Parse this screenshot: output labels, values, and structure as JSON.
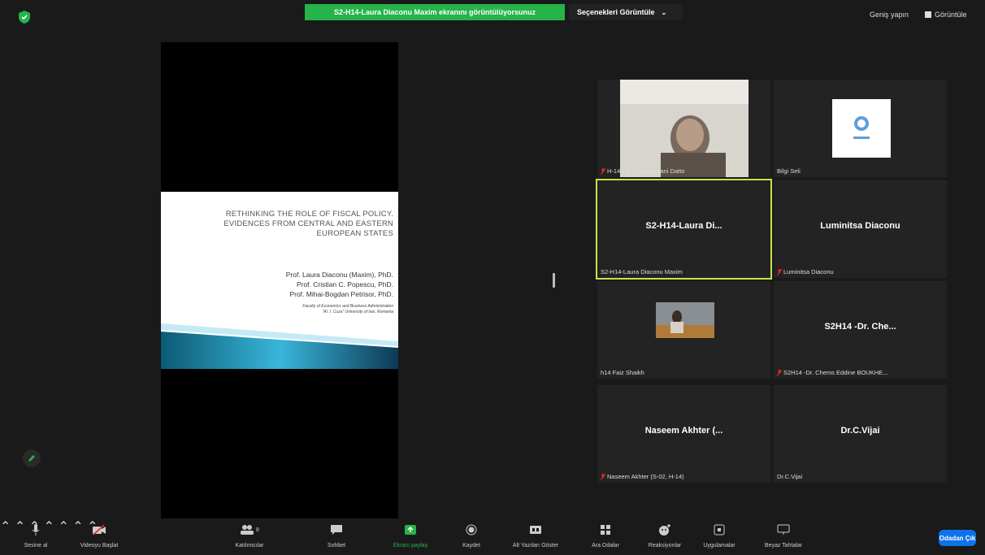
{
  "top": {
    "share_banner": "S2-H14-Laura Diaconu Maxim ekranını görüntülüyorsunuz",
    "view_options": "Seçenekleri Görüntüle",
    "exit_fullscreen": "Geniş yapın",
    "view": "Görüntüle"
  },
  "slide": {
    "title_lines": [
      "RETHINKING THE ROLE OF FISCAL POLICY.",
      "EVIDENCES FROM CENTRAL AND EASTERN",
      "EUROPEAN STATES"
    ],
    "authors": [
      "Prof. Laura Diaconu (Maxim), PhD.",
      "Prof. Cristian C. Popescu, PhD.",
      "Prof. Mihai-Bogdan Petrisor, PhD."
    ],
    "affiliation": [
      "Faculty of Economics and Business Administration",
      "\"Al. I. Cuza\" University of Iasi, Romania"
    ]
  },
  "participants": [
    {
      "caption": "H-14 Lia Frina Darsani Datto",
      "display": "",
      "muted": true
    },
    {
      "caption": "Bilgi Seli",
      "display": "",
      "muted": false
    },
    {
      "caption": "S2-H14-Laura Diaconu Maxim",
      "display": "S2-H14-Laura  Di...",
      "muted": false
    },
    {
      "caption": "Luminitsa Diaconu",
      "display": "Luminitsa Diaconu",
      "muted": true
    },
    {
      "caption": "h14 Faiz Shaikh",
      "display": "",
      "muted": false
    },
    {
      "caption": "S2H14 -Dr. Chems Eddine BOUKHE...",
      "display": "S2H14 -Dr. Che...",
      "muted": true
    },
    {
      "caption": "Naseem Akhter (S-02, H-14)",
      "display": "Naseem Akhter (...",
      "muted": true
    },
    {
      "caption": "Dr.C.Vijai",
      "display": "Dr.C.Vijai",
      "muted": false
    }
  ],
  "toolbar": {
    "audio": "Sesine al",
    "video": "Videoyu Başlat",
    "participants": "Katılımcılar",
    "participants_count": "8",
    "chat": "Sohbet",
    "share": "Ekranı paylaş",
    "record": "Kaydet",
    "captions": "Alt Yazıları Göster",
    "breakout": "Ara Odalar",
    "reactions": "Reaksiyonlar",
    "apps": "Uygulamalar",
    "whiteboard": "Beyaz Tahtalar",
    "leave": "Odadan Çık"
  },
  "colors": {
    "accent_green": "#25b34a",
    "active_speaker": "#c6e34a",
    "leave_blue": "#0e72ed",
    "muted_red": "#e02828"
  }
}
